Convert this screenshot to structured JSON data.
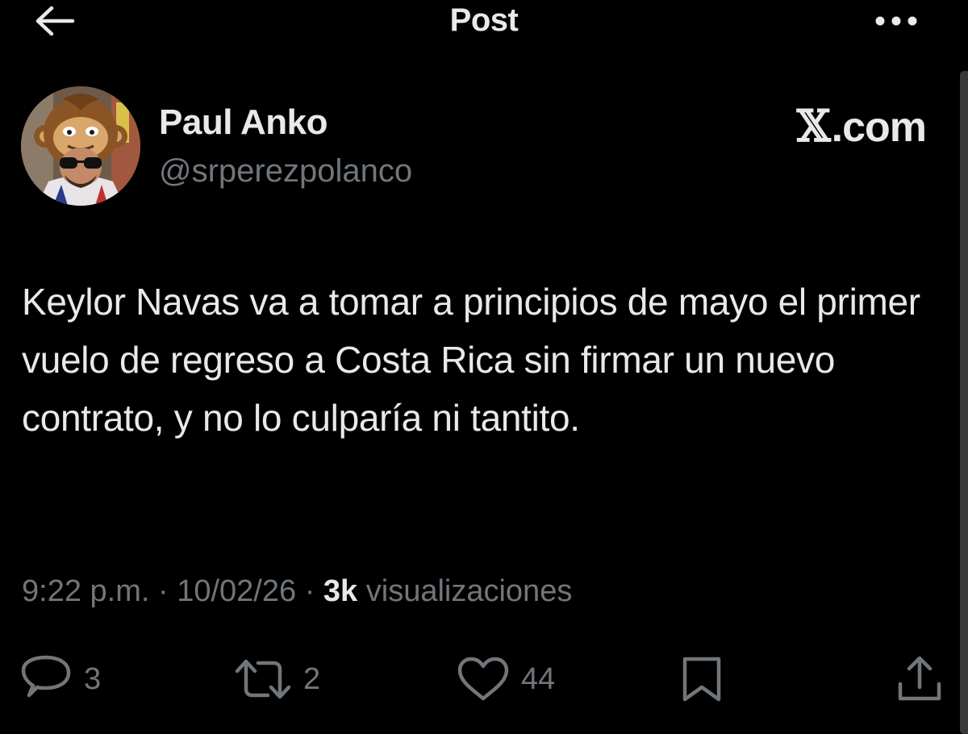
{
  "header": {
    "title": "Post",
    "back_icon": "arrow-left-icon",
    "more_icon": "more-horizontal-icon"
  },
  "author": {
    "display_name": "Paul Anko",
    "handle": "@srperezpolanco"
  },
  "watermark": {
    "x_glyph": "𝕏",
    "text": ".com"
  },
  "post": {
    "text": "Keylor Navas va a tomar a principios de mayo el primer vuelo de regreso a Costa Rica sin firmar un nuevo contrato, y no lo culparía ni tantito."
  },
  "meta": {
    "time": "9:22 p.m.",
    "separator": "·",
    "date": "10/02/26",
    "views_count": "3k",
    "views_label": "visualizaciones"
  },
  "actions": {
    "replies": "3",
    "reposts": "2",
    "likes": "44"
  },
  "colors": {
    "background": "#000000",
    "primary_text": "#e7e9ea",
    "secondary_text": "#71767b"
  }
}
